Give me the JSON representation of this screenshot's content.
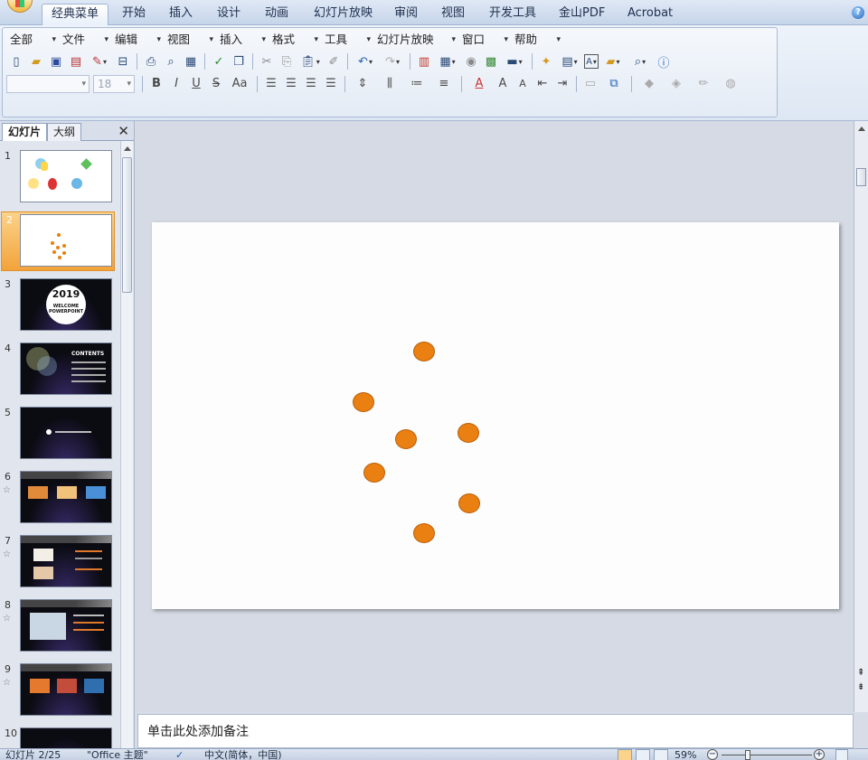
{
  "ribbon": {
    "tabs": [
      "经典菜单",
      "开始",
      "插入",
      "设计",
      "动画",
      "幻灯片放映",
      "审阅",
      "视图",
      "开发工具",
      "金山PDF",
      "Acrobat"
    ],
    "active_tab": "经典菜单",
    "help": "?"
  },
  "classic_menu": {
    "items": [
      "全部",
      "文件",
      "编辑",
      "视图",
      "插入",
      "格式",
      "工具",
      "幻灯片放映",
      "窗口",
      "帮助"
    ]
  },
  "format_bar": {
    "font_size": "18",
    "bold": "B",
    "italic": "I",
    "underline": "U",
    "strike": "S",
    "case": "Aa"
  },
  "left_pane": {
    "tab_slides": "幻灯片",
    "tab_outline": "大纲",
    "close": "✕",
    "slides": [
      {
        "num": "1",
        "star": ""
      },
      {
        "num": "2",
        "star": ""
      },
      {
        "num": "3",
        "star": "",
        "title": "2019",
        "subtitle": "WELCOME POWERPOINT"
      },
      {
        "num": "4",
        "star": "",
        "title": "CONTENTS"
      },
      {
        "num": "5",
        "star": ""
      },
      {
        "num": "6",
        "star": "☆"
      },
      {
        "num": "7",
        "star": "☆"
      },
      {
        "num": "8",
        "star": "☆"
      },
      {
        "num": "9",
        "star": "☆"
      },
      {
        "num": "10",
        "star": ""
      }
    ],
    "selected_index": 2
  },
  "notes": {
    "placeholder": "单击此处添加备注"
  },
  "status": {
    "slide_counter": "幻灯片 2/25",
    "theme": "\"Office 主题\"",
    "language": "中文(简体，中国)",
    "zoom": "59%",
    "zoom_minus": "−",
    "zoom_plus": "+"
  },
  "colors": {
    "dot_fill": "#ea7f12",
    "selected_thumb": "#f3a33a"
  }
}
